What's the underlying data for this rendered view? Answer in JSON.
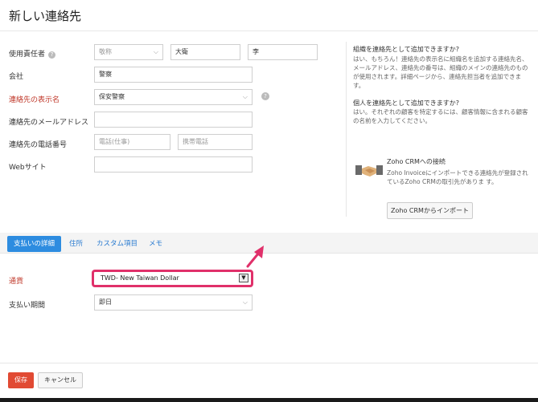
{
  "header": {
    "title": "新しい連絡先"
  },
  "form": {
    "primary_contact": {
      "label": "使用責任者",
      "salutation": "敬称",
      "first_name": "大衛",
      "last_name": "李"
    },
    "company": {
      "label": "会社",
      "value": "警察"
    },
    "display_name": {
      "label": "連絡先の表示名",
      "value": "保安警察"
    },
    "email": {
      "label": "連絡先のメールアドレス",
      "value": ""
    },
    "phone": {
      "label": "連絡先の電話番号",
      "work_placeholder": "電話(仕事)",
      "mobile_placeholder": "携帯電話"
    },
    "website": {
      "label": "Webサイト",
      "value": ""
    }
  },
  "help_glyph": "?",
  "sidebar": {
    "q1_title": "組織を連絡先として追加できますか?",
    "q1_body": "はい、もちろん！連絡先の表示名に組織名を追加する連絡先名、メールアドレス、連絡先の番号は、組織のメインの連絡先のものが使用されます。詳細ページから、連絡先担当者を追加できます。",
    "q2_title": "個人を連絡先として追加できますか?",
    "q2_body": "はい。それぞれの顧客を特定するには、顧客情報に含まれる顧客の名前を入力してください。",
    "crm_title": "Zoho CRMへの接続",
    "crm_body": "Zoho Invoiceにインポートできる連絡先が登録されているZoho CRMの取引先がありま す。",
    "crm_button": "Zoho CRMからインポート"
  },
  "tabs": [
    "支払いの詳細",
    "住所",
    "カスタム項目",
    "メモ"
  ],
  "payment": {
    "currency_label": "通貨",
    "currency_value": "TWD- New Taiwan Dollar",
    "terms_label": "支払い期間",
    "terms_value": "即日"
  },
  "actions": {
    "save": "保存",
    "cancel": "キャンセル"
  },
  "colors": {
    "accent": "#2d8ce0",
    "highlight": "#e0306a",
    "save": "#e14a33",
    "required": "#c0392b"
  }
}
